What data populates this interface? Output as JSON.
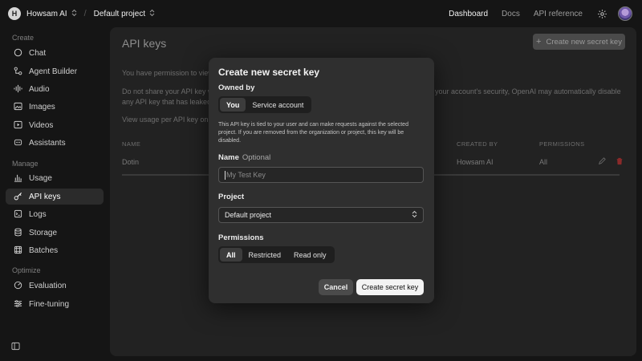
{
  "topbar": {
    "org_initial": "H",
    "org_name": "Howsam AI",
    "project_name": "Default project",
    "nav": [
      "Dashboard",
      "Docs",
      "API reference"
    ],
    "active_nav": "Dashboard"
  },
  "sidebar": {
    "sections": [
      "Create",
      "Manage",
      "Optimize"
    ],
    "items": [
      {
        "label": "Chat",
        "icon": "chat-icon"
      },
      {
        "label": "Agent Builder",
        "icon": "agent-builder-icon"
      },
      {
        "label": "Audio",
        "icon": "audio-icon"
      },
      {
        "label": "Images",
        "icon": "images-icon"
      },
      {
        "label": "Videos",
        "icon": "videos-icon"
      },
      {
        "label": "Assistants",
        "icon": "assistants-icon"
      },
      {
        "label": "Usage",
        "icon": "usage-icon"
      },
      {
        "label": "API keys",
        "icon": "key-icon",
        "active": true
      },
      {
        "label": "Logs",
        "icon": "logs-icon"
      },
      {
        "label": "Storage",
        "icon": "storage-icon"
      },
      {
        "label": "Batches",
        "icon": "batches-icon"
      },
      {
        "label": "Evaluation",
        "icon": "evaluation-icon"
      },
      {
        "label": "Fine-tuning",
        "icon": "fine-tuning-icon"
      }
    ]
  },
  "main": {
    "title": "API keys",
    "create_button": "Create new secret key",
    "para1": "You have permission to view",
    "para2a": "Do not share your API key w",
    "para2a_right": "your account's security, OpenAI may automatically disable",
    "para2b": "any API key that has leaked",
    "para3": "View usage per API key on th",
    "columns": {
      "name": "NAME",
      "created_by": "CREATED BY",
      "permissions": "PERMISSIONS"
    },
    "row": {
      "name": "Dotin",
      "created_by": "Howsam AI",
      "permissions": "All"
    }
  },
  "modal": {
    "title": "Create new secret key",
    "owned_by_label": "Owned by",
    "owned_by_options": [
      "You",
      "Service account"
    ],
    "owned_by_selected": "You",
    "note": "This API key is tied to your user and can make requests against the selected project. If you are removed from the organization or project, this key will be disabled.",
    "name_label": "Name",
    "name_optional": "Optional",
    "name_placeholder": "My Test Key",
    "project_label": "Project",
    "project_value": "Default project",
    "permissions_label": "Permissions",
    "permissions_options": [
      "All",
      "Restricted",
      "Read only"
    ],
    "permissions_selected": "All",
    "cancel_label": "Cancel",
    "submit_label": "Create secret key"
  }
}
